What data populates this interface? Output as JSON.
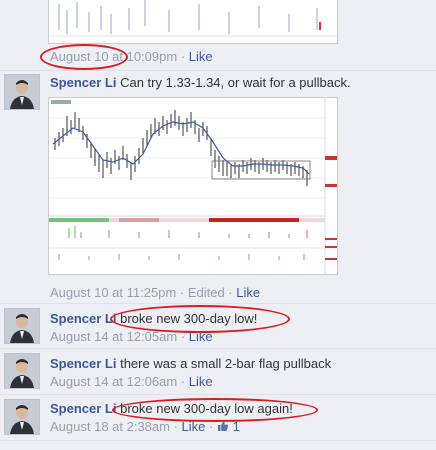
{
  "first_post": {
    "timestamp": "August 10 at 10:09pm",
    "like": "Like"
  },
  "comments": [
    {
      "author": "Spencer Li",
      "text": "Can try 1.33-1.34, or wait for a pullback.",
      "timestamp": "August 10 at 11:25pm",
      "edited": "Edited",
      "like": "Like"
    },
    {
      "author": "Spencer Li",
      "text": "broke new 300-day low!",
      "timestamp": "August 14 at 12:05am",
      "like": "Like"
    },
    {
      "author": "Spencer Li",
      "text": "there was a small 2-bar flag pullback",
      "timestamp": "August 14 at 12:06am",
      "like": "Like"
    },
    {
      "author": "Spencer Li",
      "text": "broke new 300-day low again!",
      "timestamp": "August 18 at 2:38am",
      "like": "Like",
      "like_count": "1"
    }
  ],
  "annotation_color": "#e0191f",
  "link_color": "#3b5998",
  "icons": [
    "avatar",
    "thumbs-up-icon",
    "stock-chart"
  ]
}
